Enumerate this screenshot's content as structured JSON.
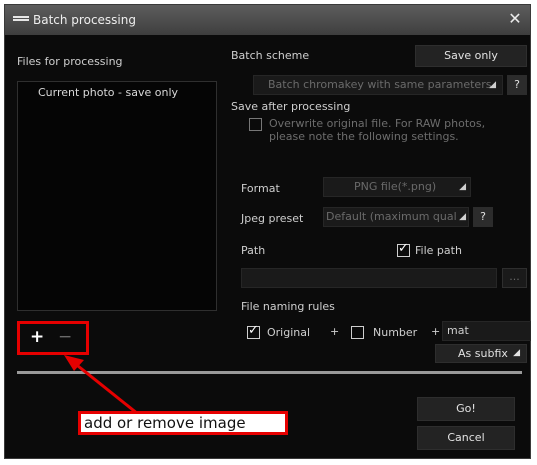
{
  "window": {
    "title": "Batch processing",
    "close_glyph": "✕"
  },
  "left": {
    "files_label": "Files for processing",
    "files": [
      "Current photo - save only"
    ],
    "add_glyph": "+",
    "remove_glyph": "−"
  },
  "right": {
    "batch_scheme_label": "Batch scheme",
    "batch_scheme_value": "Save only",
    "scheme_dropdown_value": "Batch chromakey with same parameters",
    "help_glyph": "?",
    "save_after_label": "Save after processing",
    "overwrite_text": "Overwrite original file. For RAW photos, please note the following settings.",
    "format_label": "Format",
    "format_value": "PNG file(*.png)",
    "jpeg_preset_label": "Jpeg preset",
    "jpeg_preset_value": "Default (maximum quali",
    "path_label": "Path",
    "file_path_label": "File path",
    "path_value": "",
    "browse_label": "...",
    "naming_rules_label": "File naming rules",
    "original_label": "Original",
    "plus_sep": "+",
    "number_label": "Number",
    "suffix_value": "mat",
    "subfix_value": "As subfix",
    "dropdown_glyph": "◢"
  },
  "footer": {
    "go_label": "Go!",
    "cancel_label": "Cancel"
  },
  "annotation": {
    "callout_text": "add or remove image"
  },
  "colors": {
    "annotation_red": "#e60000",
    "window_bg": "#0b0b0b"
  }
}
